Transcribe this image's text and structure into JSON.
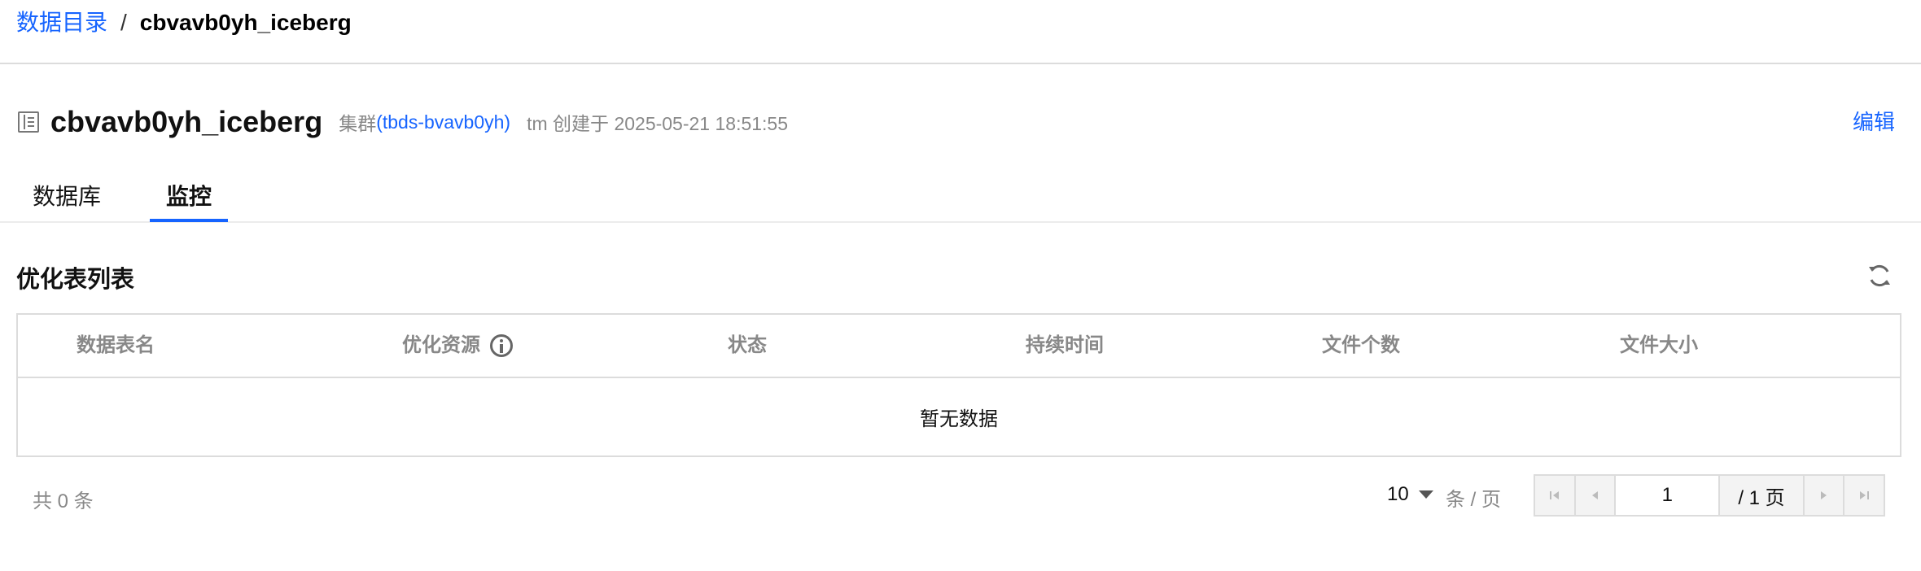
{
  "breadcrumb": {
    "root": "数据目录",
    "separator": "/",
    "current": "cbvavb0yh_iceberg"
  },
  "header": {
    "title": "cbvavb0yh_iceberg",
    "cluster_prefix": "集群",
    "cluster_link": "(tbds-bvavb0yh)",
    "created": "tm 创建于 2025-05-21 18:51:55",
    "edit_label": "编辑"
  },
  "tabs": [
    {
      "label": "数据库",
      "active": false
    },
    {
      "label": "监控",
      "active": true
    }
  ],
  "section": {
    "title": "优化表列表"
  },
  "table": {
    "columns": [
      "数据表名",
      "优化资源",
      "状态",
      "持续时间",
      "文件个数",
      "文件大小"
    ],
    "rows": [],
    "empty_text": "暂无数据"
  },
  "pagination": {
    "total": "共 0 条",
    "page_size": "10",
    "per_page_label": "条 / 页",
    "current_page": "1",
    "total_pages": "/ 1 页"
  },
  "colors": {
    "accent": "#1664ff",
    "muted": "#888888",
    "border": "#dcdcdc"
  },
  "icons": [
    "table-icon",
    "info-icon",
    "refresh-icon",
    "first-page-icon",
    "prev-page-icon",
    "next-page-icon",
    "last-page-icon",
    "dropdown-caret-icon"
  ]
}
